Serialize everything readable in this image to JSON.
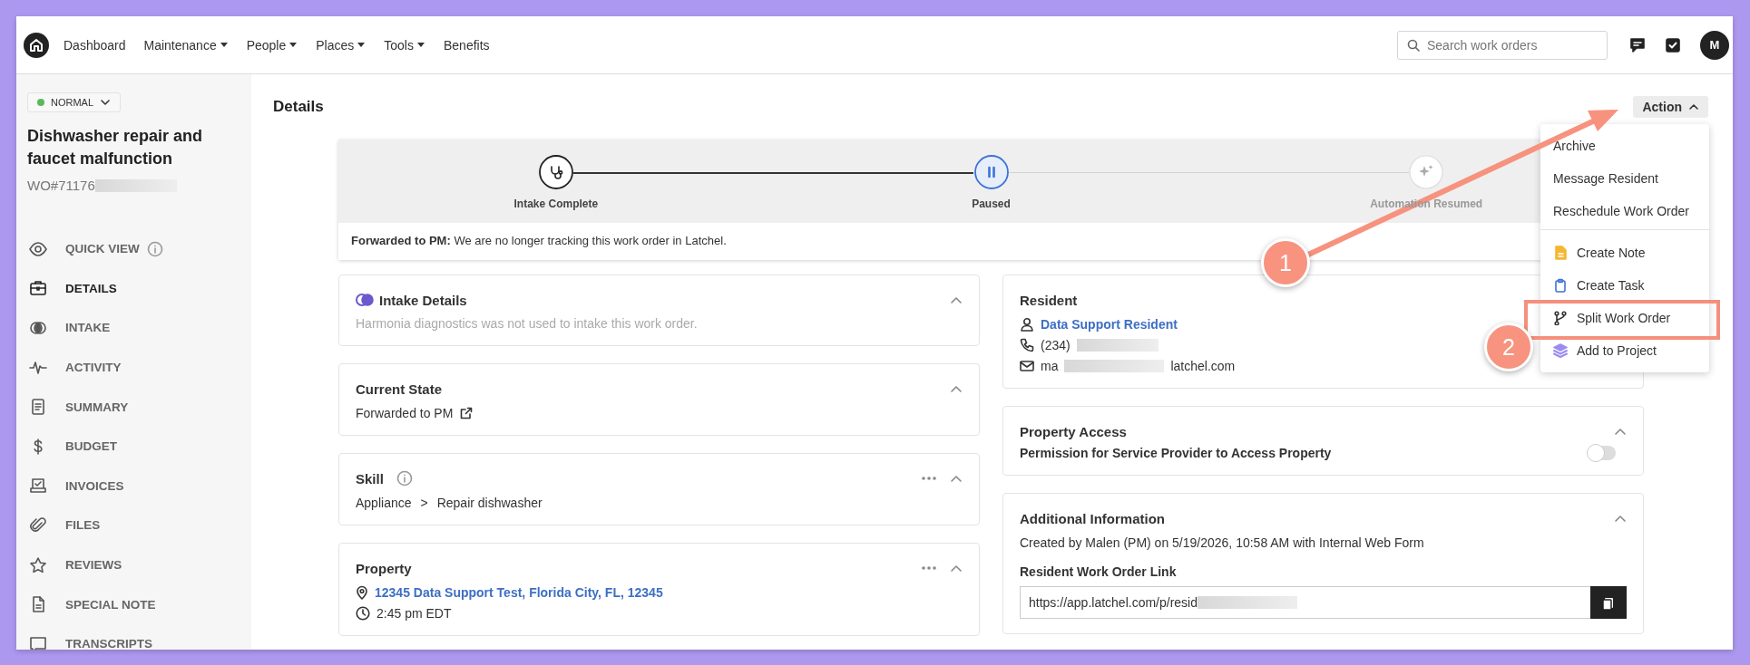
{
  "nav": {
    "items": [
      {
        "label": "Dashboard",
        "has_menu": false
      },
      {
        "label": "Maintenance",
        "has_menu": true
      },
      {
        "label": "People",
        "has_menu": true
      },
      {
        "label": "Places",
        "has_menu": true
      },
      {
        "label": "Tools",
        "has_menu": true
      },
      {
        "label": "Benefits",
        "has_menu": false
      }
    ],
    "search": {
      "placeholder": "Search work orders"
    },
    "avatar": {
      "initial": "M"
    }
  },
  "sidebar": {
    "status": {
      "label": "NORMAL",
      "color": "#5cb85c"
    },
    "title": "Dishwasher repair and faucet malfunction",
    "work_order_number": "WO#71176",
    "items": [
      {
        "label": "QUICK VIEW",
        "selected": false,
        "info": true
      },
      {
        "label": "DETAILS",
        "selected": true,
        "info": false
      },
      {
        "label": "INTAKE",
        "selected": false,
        "info": false
      },
      {
        "label": "ACTIVITY",
        "selected": false,
        "info": false
      },
      {
        "label": "SUMMARY",
        "selected": false,
        "info": false
      },
      {
        "label": "BUDGET",
        "selected": false,
        "info": false
      },
      {
        "label": "INVOICES",
        "selected": false,
        "info": false
      },
      {
        "label": "FILES",
        "selected": false,
        "info": false
      },
      {
        "label": "REVIEWS",
        "selected": false,
        "info": false
      },
      {
        "label": "SPECIAL NOTE",
        "selected": false,
        "info": false
      },
      {
        "label": "TRANSCRIPTS",
        "selected": false,
        "info": false
      }
    ]
  },
  "page": {
    "title": "Details",
    "action_button": {
      "label": "Action",
      "expanded": true
    }
  },
  "action_menu": {
    "groups": [
      [
        "Archive",
        "Message Resident",
        "Reschedule Work Order"
      ],
      [
        "Create Note",
        "Create Task",
        "Split Work Order",
        "Add to Project"
      ]
    ]
  },
  "progress": {
    "steps": [
      {
        "label": "Intake Complete",
        "completed": true,
        "active": false
      },
      {
        "label": "Paused",
        "completed": false,
        "active": true
      },
      {
        "label": "Automation Resumed",
        "completed": false,
        "active": false
      }
    ],
    "note": "**Forwarded to PM:** We are no longer tracking this work order in Latchel."
  },
  "cards_left": [
    {
      "kind": "intake",
      "title": "Intake Details",
      "expanded": true,
      "has_menu": false,
      "description": "Harmonia diagnostics was not used to intake this work order."
    },
    {
      "kind": "state",
      "title": "Current State",
      "expanded": true,
      "has_menu": false,
      "value": "Forwarded to PM"
    },
    {
      "kind": "skill",
      "title": "Skill",
      "expanded": true,
      "has_menu": true,
      "path": [
        "Appliance",
        "Repair dishwasher"
      ],
      "separator": ">"
    },
    {
      "kind": "property",
      "title": "Property",
      "expanded": true,
      "has_menu": true,
      "address": "12345 Data Support Test, Florida City, FL, 12345",
      "time": "2:45 pm EDT"
    }
  ],
  "cards_right": [
    {
      "kind": "resident",
      "title": "Resident",
      "has_menu": false,
      "name": "Data Support Resident",
      "phone": "(234)",
      "email_start": "ma",
      "email_end": "latchel.com"
    },
    {
      "kind": "access",
      "title": "Property Access",
      "expanded": true,
      "has_menu": false,
      "permission": {
        "label": "Permission for Service Provider to Access Property",
        "on": false
      }
    },
    {
      "kind": "info",
      "title": "Additional Information",
      "expanded": true,
      "has_menu": false,
      "created": "Created by Malen (PM) on 5/19/2026, 10:58 AM with Internal Web Form",
      "link_label": "Resident Work Order Link",
      "link_value": "https://app.latchel.com/p/resid"
    }
  ],
  "annotations": {
    "badges": [
      "1",
      "2"
    ]
  }
}
